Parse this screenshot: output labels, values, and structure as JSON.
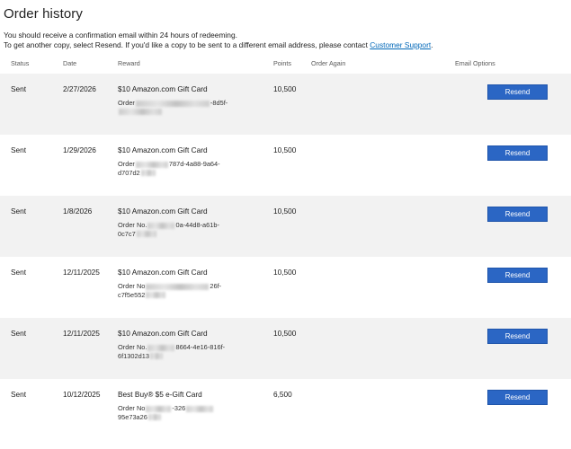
{
  "page": {
    "title": "Order history",
    "intro_line1": "You should receive a confirmation email within 24 hours of redeeming.",
    "intro_line2_prefix": "To get another copy, select Resend. If you'd like a copy to be sent to a different email address, please contact ",
    "support_link": "Customer Support",
    "intro_line2_suffix": "."
  },
  "columns": {
    "status": "Status",
    "date": "Date",
    "reward": "Reward",
    "points": "Points",
    "order_again": "Order Again",
    "email_options": "Email Options"
  },
  "orders": [
    {
      "status": "Sent",
      "date": "2/27/2026",
      "reward": "$10 Amazon.com Gift Card",
      "points": "10,500",
      "order_prefix": "Order",
      "order_visible_a": "-8d5f-",
      "order_visible_b": "",
      "resend_label": "Resend"
    },
    {
      "status": "Sent",
      "date": "1/29/2026",
      "reward": "$10 Amazon.com Gift Card",
      "points": "10,500",
      "order_prefix": "Order",
      "order_visible_a": "787d-4a88-9a64-",
      "order_visible_b": "d707d2",
      "resend_label": "Resend"
    },
    {
      "status": "Sent",
      "date": "1/8/2026",
      "reward": "$10 Amazon.com Gift Card",
      "points": "10,500",
      "order_prefix": "Order No.",
      "order_visible_a": "0a-44d8-a61b-",
      "order_visible_b": "0c7c7",
      "resend_label": "Resend"
    },
    {
      "status": "Sent",
      "date": "12/11/2025",
      "reward": "$10 Amazon.com Gift Card",
      "points": "10,500",
      "order_prefix": "Order No",
      "order_visible_a": "26f-",
      "order_visible_b": "c7f5e552",
      "resend_label": "Resend"
    },
    {
      "status": "Sent",
      "date": "12/11/2025",
      "reward": "$10 Amazon.com Gift Card",
      "points": "10,500",
      "order_prefix": "Order No.",
      "order_visible_a": "8664-4e16-816f-",
      "order_visible_b": "6f1302d13",
      "resend_label": "Resend"
    },
    {
      "status": "Sent",
      "date": "10/12/2025",
      "reward": "Best Buy® $5 e-Gift Card",
      "points": "6,500",
      "order_prefix": "Order No",
      "order_visible_a": "-326",
      "order_visible_b": "95e73a26",
      "resend_label": "Resend"
    }
  ],
  "colors": {
    "button_blue": "#2b66c4",
    "link_blue": "#0067b8",
    "alt_row_gray": "#f2f2f2"
  }
}
